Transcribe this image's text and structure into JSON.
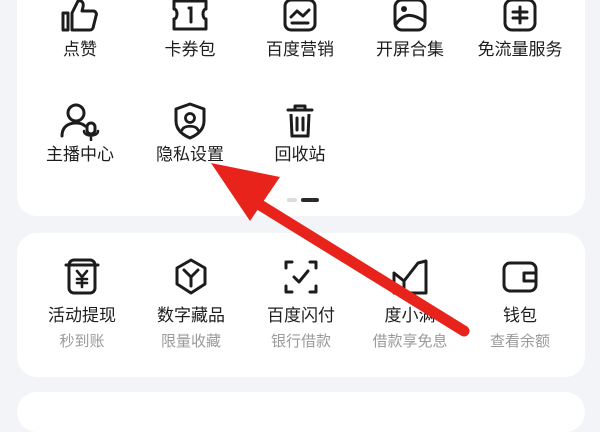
{
  "section_top": {
    "row1": [
      {
        "label": "点赞",
        "icon": "thumbs-up-icon"
      },
      {
        "label": "卡券包",
        "icon": "ticket-icon"
      },
      {
        "label": "百度营销",
        "icon": "marketing-chart-icon"
      },
      {
        "label": "开屏合集",
        "icon": "image-gallery-icon"
      },
      {
        "label": "免流量服务",
        "icon": "data-free-icon"
      }
    ],
    "row2": [
      {
        "label": "主播中心",
        "icon": "streamer-mic-icon"
      },
      {
        "label": "隐私设置",
        "icon": "privacy-shield-icon"
      },
      {
        "label": "回收站",
        "icon": "trash-icon"
      }
    ]
  },
  "section_finance": {
    "items": [
      {
        "label": "活动提现",
        "sub": "秒到账",
        "icon": "withdraw-yuan-icon"
      },
      {
        "label": "数字藏品",
        "sub": "限量收藏",
        "icon": "digital-collectible-icon"
      },
      {
        "label": "百度闪付",
        "sub": "银行借款",
        "icon": "flash-pay-icon"
      },
      {
        "label": "度小满",
        "sub": "借款享免息",
        "icon": "duxiaoman-icon"
      },
      {
        "label": "钱包",
        "sub": "查看余额",
        "icon": "wallet-icon"
      }
    ]
  },
  "annotation": {
    "color": "#e8231c"
  }
}
